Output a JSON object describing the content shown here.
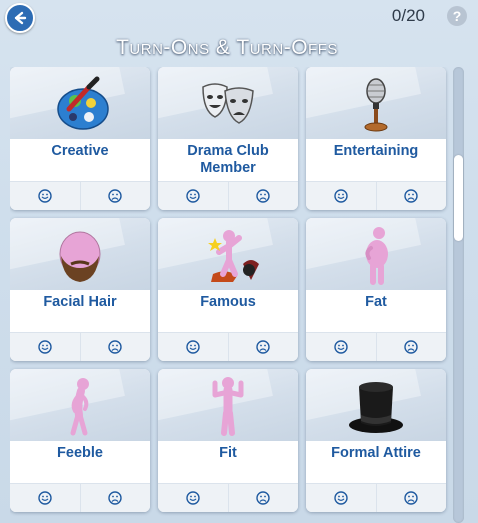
{
  "header": {
    "counter": "0/20",
    "help_symbol": "?",
    "title": "Turn-Ons & Turn-Offs"
  },
  "cards": [
    {
      "label": "Creative",
      "icon": "paint-palette-icon"
    },
    {
      "label": "Drama Club Member",
      "icon": "theater-masks-icon"
    },
    {
      "label": "Entertaining",
      "icon": "microphone-icon"
    },
    {
      "label": "Facial Hair",
      "icon": "bearded-head-icon"
    },
    {
      "label": "Famous",
      "icon": "famous-star-figure-icon"
    },
    {
      "label": "Fat",
      "icon": "fat-figure-icon"
    },
    {
      "label": "Feeble",
      "icon": "feeble-figure-icon"
    },
    {
      "label": "Fit",
      "icon": "fit-figure-icon"
    },
    {
      "label": "Formal Attire",
      "icon": "top-hat-icon"
    }
  ],
  "colors": {
    "accent_blue": "#1f5aa0",
    "back_button": "#2d6cb4",
    "figure_pink": "#e7a4d6"
  }
}
